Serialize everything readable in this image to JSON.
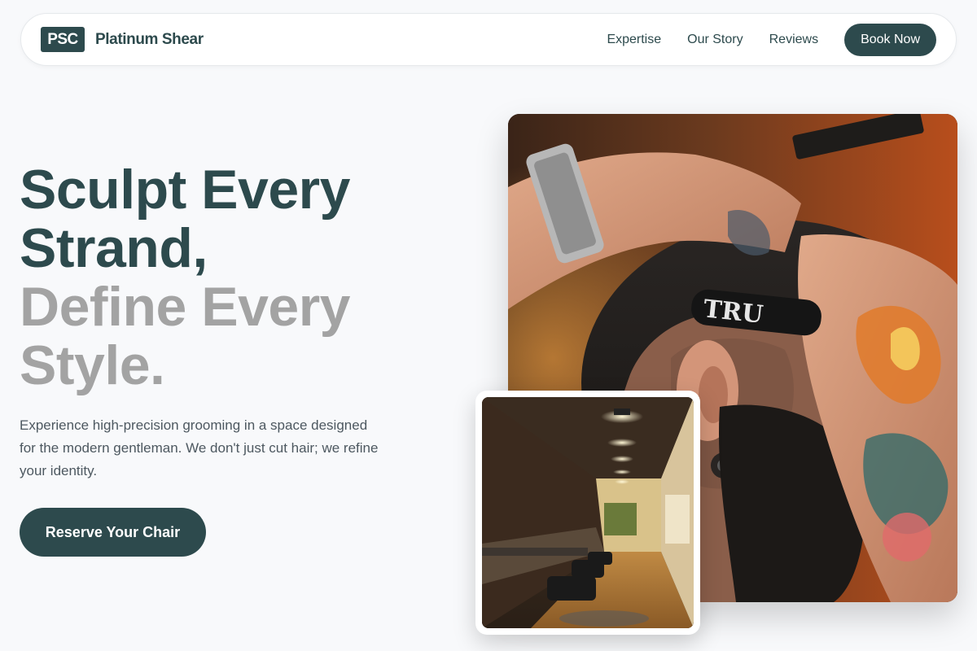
{
  "nav": {
    "logo_mark": "PSC",
    "brand": "Platinum Shear",
    "links": [
      "Expertise",
      "Our Story",
      "Reviews"
    ],
    "cta": "Book Now"
  },
  "hero": {
    "title_line1": "Sculpt Every",
    "title_line2": "Strand,",
    "title_line3": "Define Every",
    "title_line4": "Style.",
    "description": "Experience high-precision grooming in a space designed for the modern gentleman. We don't just cut hair; we refine your identity.",
    "cta": "Reserve Your Chair"
  },
  "images": {
    "main_razor_text": "TRU"
  },
  "colors": {
    "brand": "#2d4a4d",
    "muted_title": "#a3a3a3",
    "background": "#f8f9fb"
  }
}
